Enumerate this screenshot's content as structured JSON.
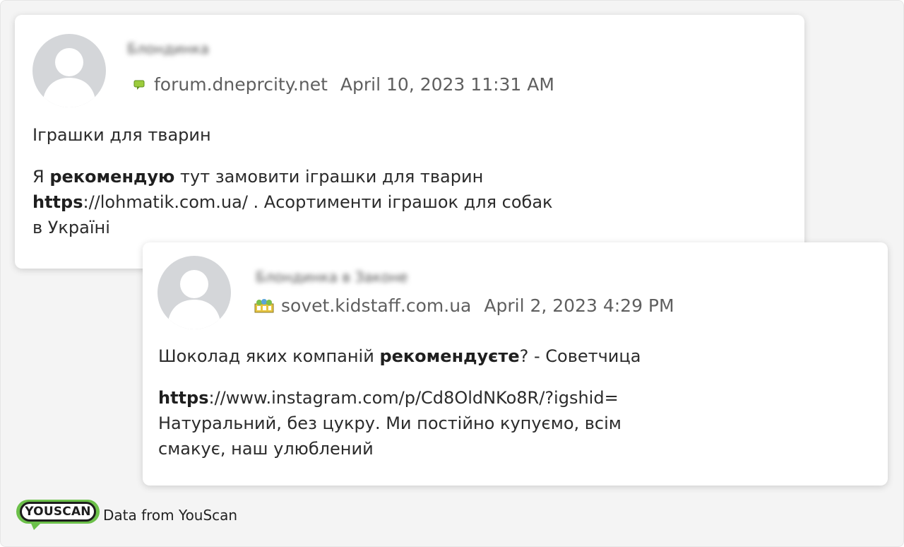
{
  "posts": [
    {
      "author": "Блондинка",
      "source": "forum.dneprcity.net",
      "date": "April 10, 2023 11:31 AM",
      "title": "Іграшки для тварин",
      "body": {
        "line1_pre": "Я ",
        "line1_hl": "рекомендую",
        "line1_post": " тут замовити іграшки для тварин",
        "line2_hl": "https",
        "line2_post": "://lohmatik.com.ua/ . Асортименти іграшок для собак",
        "line3": "в Україні"
      },
      "source_icon": "forum-speech-icon"
    },
    {
      "author": "Блондинка в Законе",
      "source": "sovet.kidstaff.com.ua",
      "date": "April 2, 2023 4:29 PM",
      "title": {
        "pre": "Шоколад яких компаній ",
        "hl": "рекомендуєте",
        "post": "? - Советчица"
      },
      "body": {
        "line1_hl": "https",
        "line1_post": "://www.instagram.com/p/Cd8OldNKo8R/?igshid=",
        "line2": "Натуральний, без цукру. Ми постійно купуємо, всім",
        "line3": "смакує, наш улюблений"
      },
      "source_icon": "kidstaff-site-icon"
    }
  ],
  "footer": {
    "logo_text": "YOUSCAN",
    "caption": "Data from YouScan"
  },
  "colors": {
    "logo_green": "#6cc04a",
    "forum_icon": "#9ccc3c"
  }
}
